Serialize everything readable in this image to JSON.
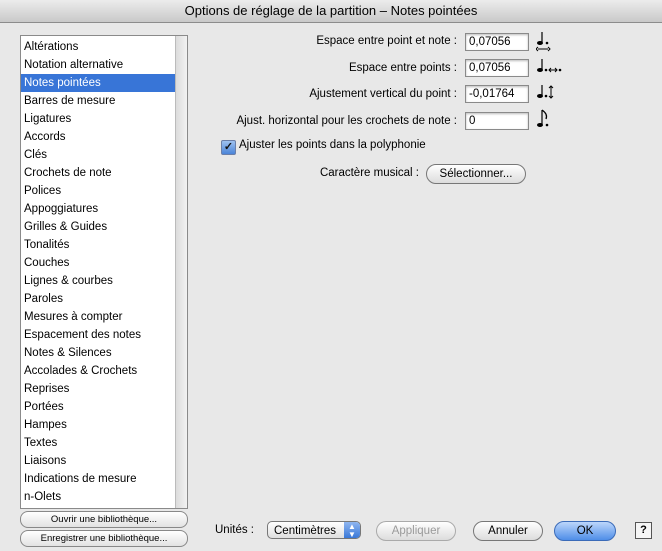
{
  "window": {
    "title": "Options de réglage de la partition – Notes pointées"
  },
  "sidebar": {
    "items": [
      "Altérations",
      "Notation alternative",
      "Notes pointées",
      "Barres de mesure",
      "Ligatures",
      "Accords",
      "Clés",
      "Crochets de note",
      "Polices",
      "Appoggiatures",
      "Grilles & Guides",
      "Tonalités",
      "Couches",
      "Lignes & courbes",
      "Paroles",
      "Mesures à compter",
      "Espacement des notes",
      "Notes & Silences",
      "Accolades & Crochets",
      "Reprises",
      "Portées",
      "Hampes",
      "Textes",
      "Liaisons",
      "Indications de mesure",
      "n-Olets"
    ],
    "selected": "Notes pointées",
    "open_library": "Ouvrir une bibliothèque...",
    "save_library": "Enregistrer une bibliothèque..."
  },
  "form": {
    "dot_note_space": {
      "label": "Espace entre point et note :",
      "value": "0,07056",
      "icon": "note-dot-horizontal-icon"
    },
    "dots_space": {
      "label": "Espace entre points :",
      "value": "0,07056",
      "icon": "double-dot-horizontal-icon"
    },
    "vertical_adjust": {
      "label": "Ajustement vertical du point :",
      "value": "-0,01764",
      "icon": "note-dot-vertical-icon"
    },
    "horizontal_flag": {
      "label": "Ajust. horizontal pour les crochets de note :",
      "value": "0",
      "icon": "flagged-note-icon"
    },
    "polyphony": {
      "label": "Ajuster les points dans la polyphonie",
      "checked": true
    },
    "music_char": {
      "label": "Caractère musical :",
      "button": "Sélectionner..."
    }
  },
  "footer": {
    "units_label": "Unités :",
    "units_value": "Centimètres",
    "apply": "Appliquer",
    "cancel": "Annuler",
    "ok": "OK",
    "help": "?"
  }
}
